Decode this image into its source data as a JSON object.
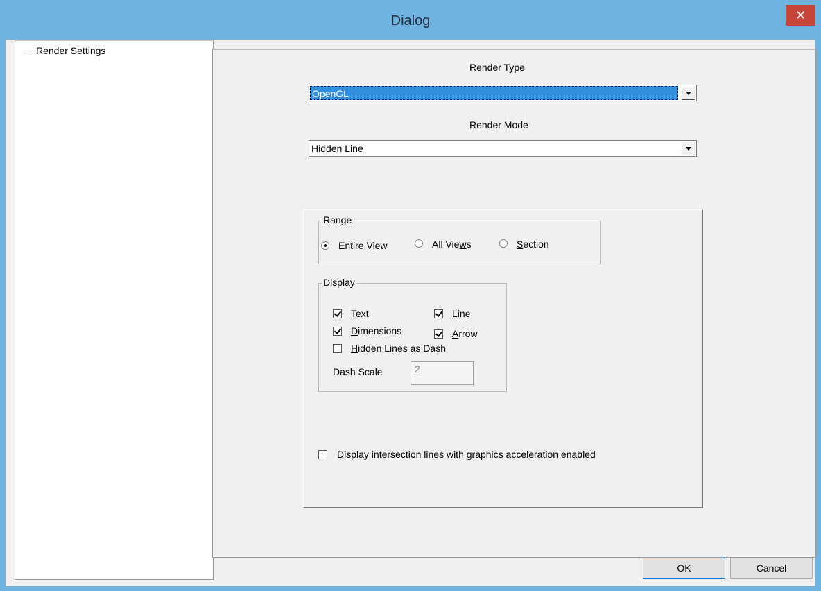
{
  "window": {
    "title": "Dialog"
  },
  "tree": {
    "items": [
      {
        "label": "Render Settings"
      }
    ]
  },
  "render_type": {
    "label": "Render Type",
    "value": "OpenGL"
  },
  "render_mode": {
    "label": "Render Mode",
    "value": "Hidden Line"
  },
  "range": {
    "title": "Range",
    "options": [
      {
        "label": "Entire View",
        "checked": true
      },
      {
        "label": "All Views",
        "checked": false
      },
      {
        "label": "Section",
        "checked": false
      }
    ]
  },
  "display": {
    "title": "Display",
    "text_label": "Text",
    "dimensions_label": "Dimensions",
    "line_label": "Line",
    "arrow_label": "Arrow",
    "hidden_lines_label": "Hidden Lines as Dash",
    "dash_scale_label": "Dash Scale",
    "dash_scale_value": "2"
  },
  "intersection_label": "Display intersection lines with graphics acceleration enabled",
  "buttons": {
    "ok": "OK",
    "cancel": "Cancel"
  }
}
